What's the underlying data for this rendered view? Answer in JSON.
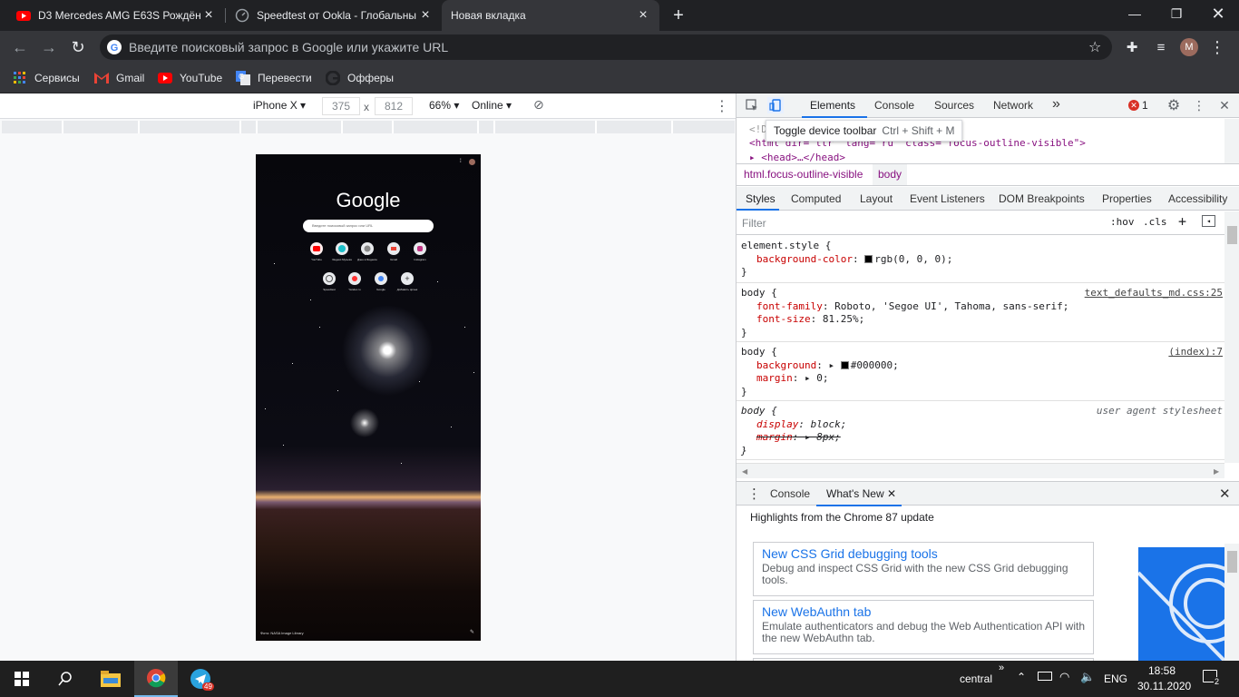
{
  "tabs": [
    {
      "title": "D3 Mercedes AMG E63S Рождён",
      "favicon": "youtube-icon",
      "active": false
    },
    {
      "title": "Speedtest от Ookla - Глобальны",
      "favicon": "speedtest-icon",
      "active": false
    },
    {
      "title": "Новая вкладка",
      "favicon": "",
      "active": true
    }
  ],
  "toolbar": {
    "omnibox_placeholder": "Введите поисковый запрос в Google или укажите URL",
    "profile_initial": "M"
  },
  "bookmarks": [
    {
      "label": "Сервисы",
      "icon": "apps-grid-icon"
    },
    {
      "label": "Gmail",
      "icon": "gmail-icon"
    },
    {
      "label": "YouTube",
      "icon": "youtube-icon"
    },
    {
      "label": "Перевести",
      "icon": "translate-icon"
    },
    {
      "label": "Офферы",
      "icon": "google-g-icon"
    }
  ],
  "device_toolbar": {
    "device": "iPhone X",
    "width": "375",
    "times": "x",
    "height": "812",
    "zoom": "66%",
    "throttle": "Online"
  },
  "phone": {
    "logo": "Google",
    "search_placeholder": "Введите поисковый запрос или URL",
    "footer": "Фото: NASA Image Library",
    "shortcuts_row1": [
      "YouTube",
      "Яндекс.Музыка",
      "Дзен в Яндексе",
      "Gmail",
      "Instagram"
    ],
    "shortcuts_row2": [
      "Speedtest",
      "Yandex.ru",
      "Google",
      "Добавить ярлык"
    ]
  },
  "devtools": {
    "tabs": [
      "Elements",
      "Console",
      "Sources",
      "Network"
    ],
    "more_tabs": "»",
    "error_count": "1",
    "tooltip_label": "Toggle device toolbar",
    "tooltip_shortcut": "Ctrl + Shift + M",
    "dom": {
      "line1": "<!DOCTYPE html>",
      "line2": "<html dir=\"ltr\" lang=\"ru\" class=\"focus-outline-visible\">",
      "line3": "<head>…</head>"
    },
    "breadcrumbs": [
      "html.focus-outline-visible",
      "body"
    ],
    "style_tabs": [
      "Styles",
      "Computed",
      "Layout",
      "Event Listeners",
      "DOM Breakpoints",
      "Properties",
      "Accessibility"
    ],
    "filter_placeholder": "Filter",
    "hov": ":hov",
    "cls": ".cls",
    "rules": [
      {
        "selector": "element.style {",
        "source": "",
        "props": [
          {
            "name": "background-color",
            "value": "rgb(0, 0, 0);",
            "swatch": true
          }
        ]
      },
      {
        "selector": "body {",
        "source": "text_defaults_md.css:25",
        "props": [
          {
            "name": "font-family",
            "value": "Roboto, 'Segoe UI', Tahoma, sans-serif;"
          },
          {
            "name": "font-size",
            "value": "81.25%;"
          }
        ]
      },
      {
        "selector": "body {",
        "source": "(index):7",
        "props": [
          {
            "name": "background",
            "value": "#000000;"
          },
          {
            "name": "margin",
            "value": "0;"
          }
        ]
      },
      {
        "selector": "body {",
        "source": "user agent stylesheet",
        "props": [
          {
            "name": "display",
            "value": "block;"
          },
          {
            "name": "margin",
            "value": "8px;"
          }
        ]
      }
    ],
    "close_brace": "}",
    "drawer_tabs": [
      "Console",
      "What's New"
    ],
    "whats_new_header": "Highlights from the Chrome 87 update",
    "cards": [
      {
        "title": "New CSS Grid debugging tools",
        "desc": "Debug and inspect CSS Grid with the new CSS Grid debugging tools."
      },
      {
        "title": "New WebAuthn tab",
        "desc": "Emulate authenticators and debug the Web Authentication API with the new WebAuthn tab."
      }
    ]
  },
  "taskbar": {
    "network_name": "central",
    "lang": "ENG",
    "time": "18:58",
    "date": "30.11.2020",
    "notifications": "2",
    "telegram_badge": "49"
  },
  "colors": {
    "tabstrip": "#202124",
    "toolbar": "#35363a",
    "accent": "#1a73e8",
    "taskbar": "#1f1f1f"
  }
}
